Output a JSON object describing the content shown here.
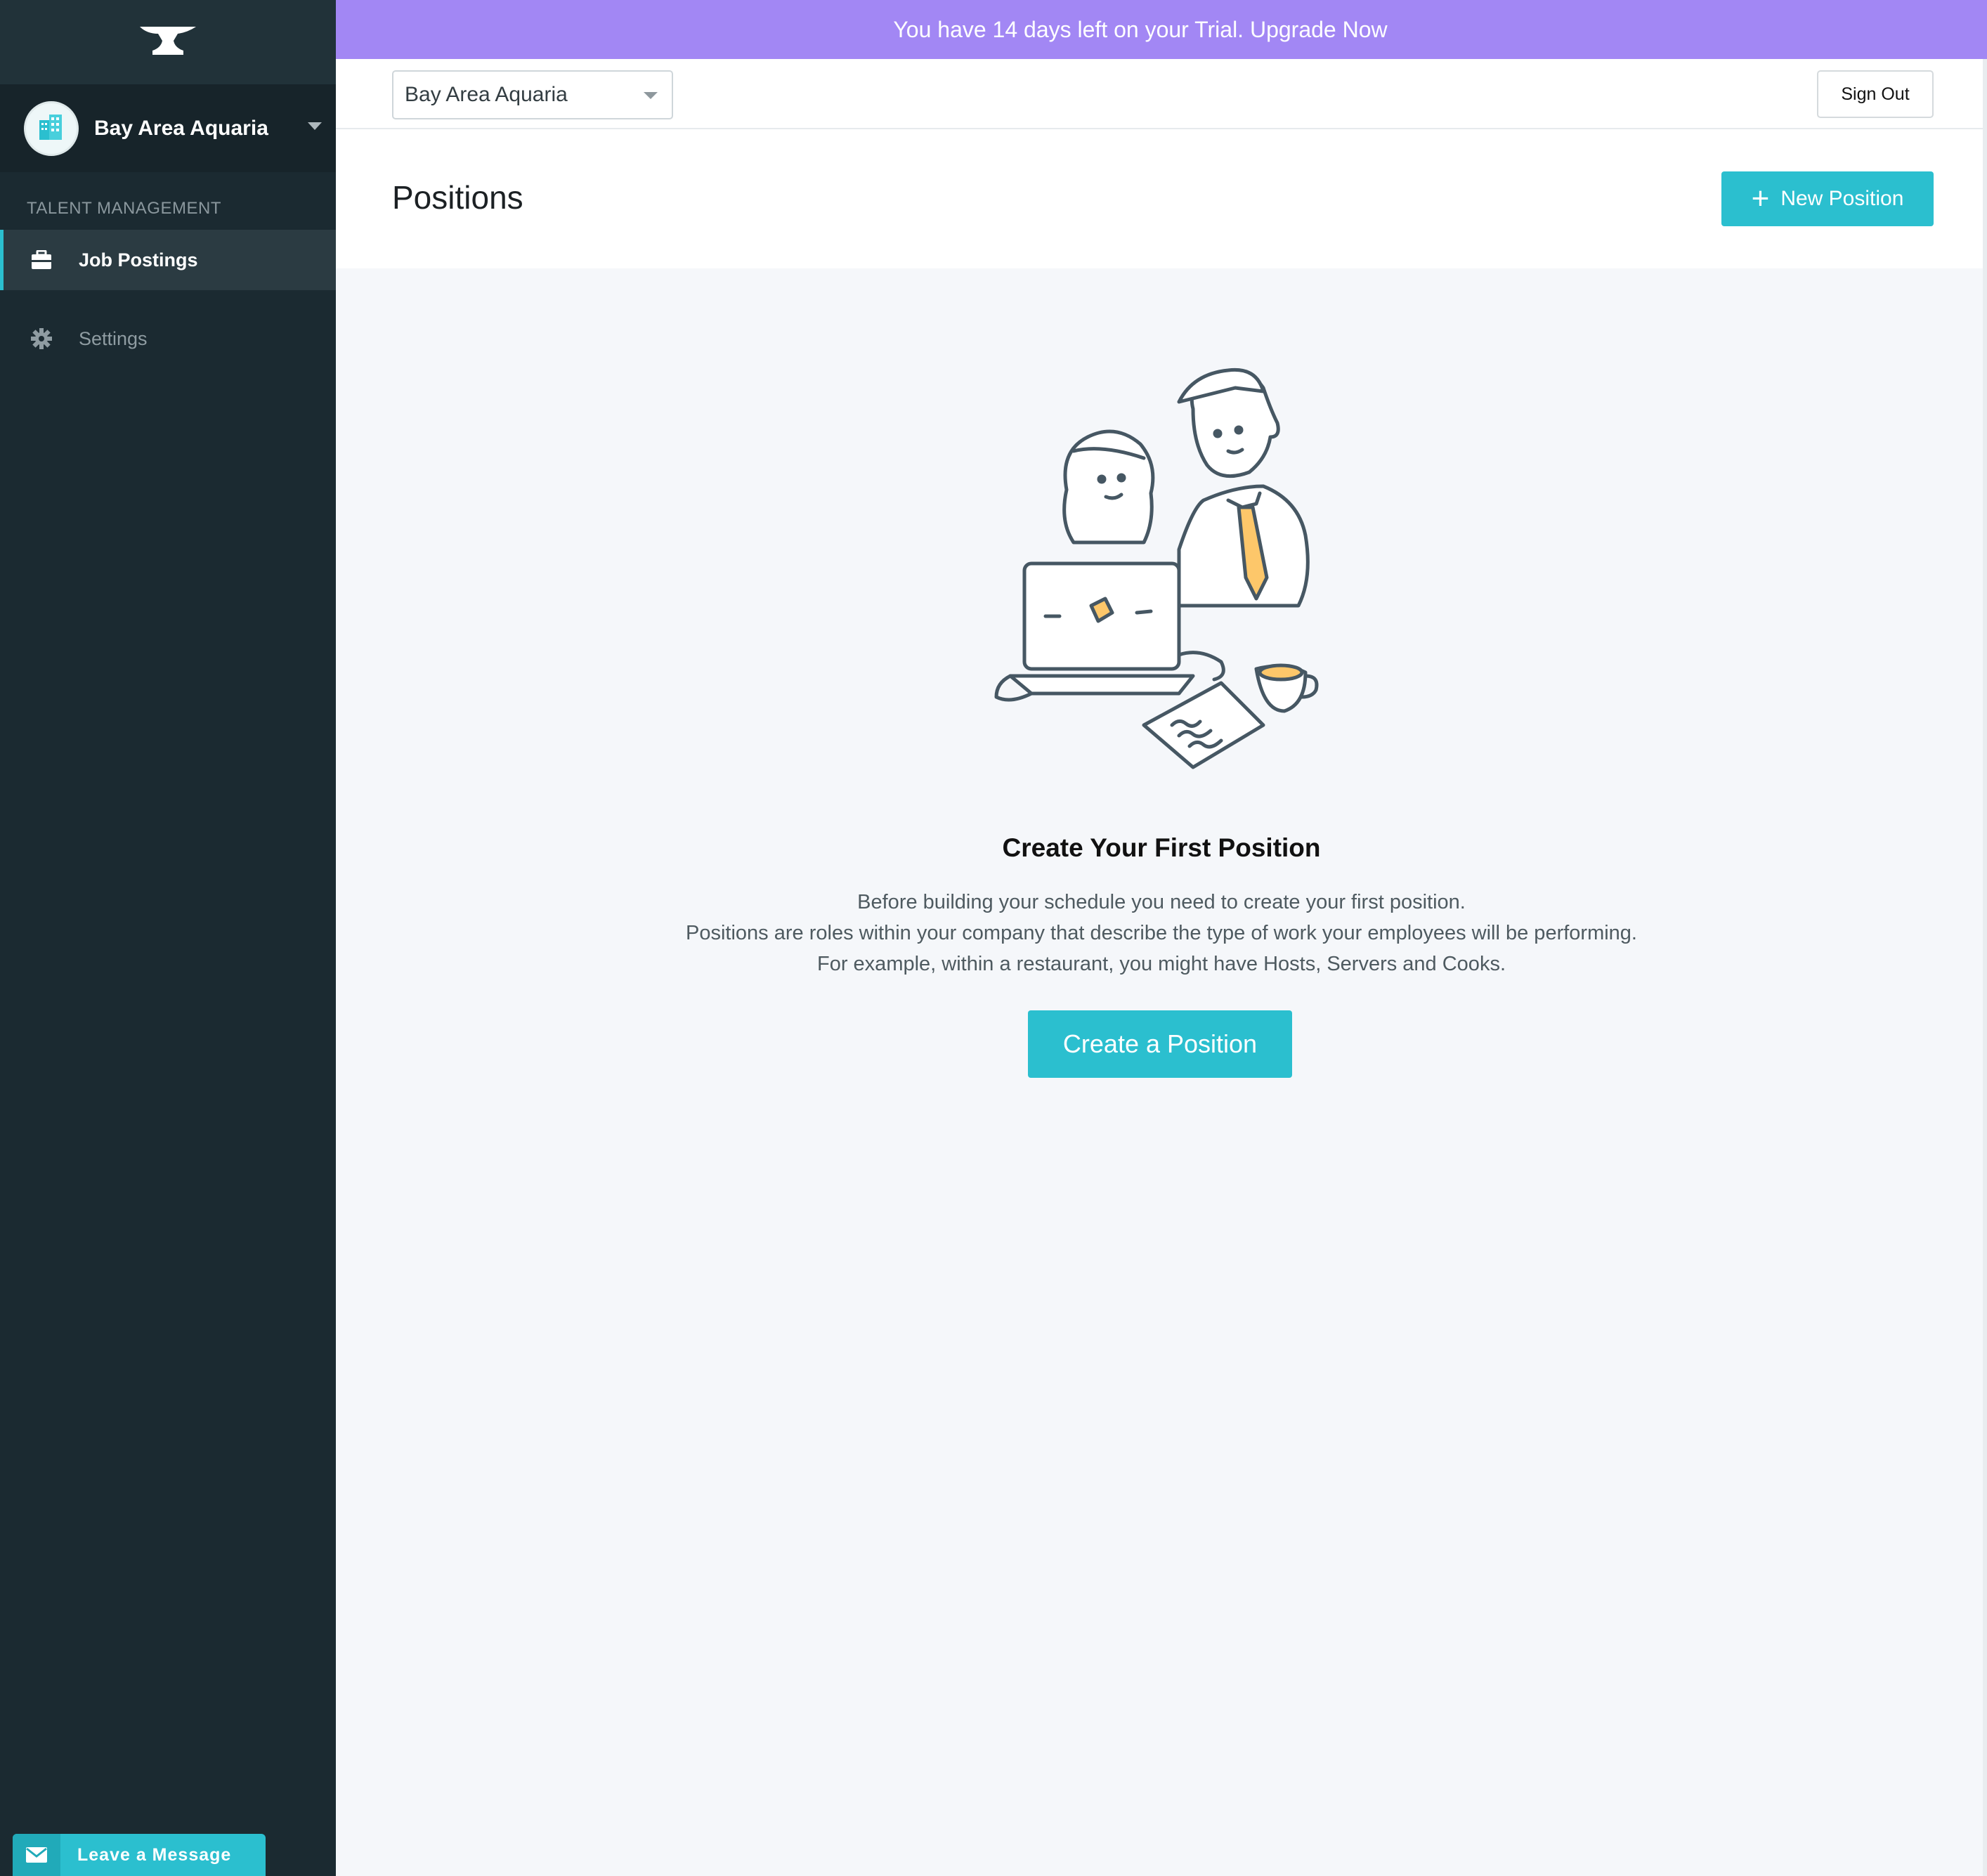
{
  "sidebar": {
    "account_name": "Bay Area Aquaria",
    "section_title": "TALENT MANAGEMENT",
    "items": [
      {
        "label": "Job Postings",
        "icon": "briefcase-icon",
        "active": true
      },
      {
        "label": "Settings",
        "icon": "gear-icon",
        "active": false
      }
    ],
    "leave_message": "Leave a Message"
  },
  "banner": {
    "text": "You have 14 days left on your Trial. Upgrade Now"
  },
  "topbar": {
    "location_value": "Bay Area Aquaria",
    "sign_out_label": "Sign Out"
  },
  "page": {
    "title": "Positions",
    "new_position_label": "New Position"
  },
  "empty_state": {
    "title": "Create Your First Position",
    "lines": [
      "Before building your schedule you need to create your first position.",
      "Positions are roles within your company that describe the type of work your employees will be performing.",
      "For example, within a restaurant, you might have Hosts, Servers and Cooks."
    ],
    "button_label": "Create a Position"
  },
  "colors": {
    "sidebar_bg": "#1b2a31",
    "banner_bg": "#a287f4",
    "accent": "#2bbfcf",
    "illustration_highlight": "#fdc76a"
  }
}
